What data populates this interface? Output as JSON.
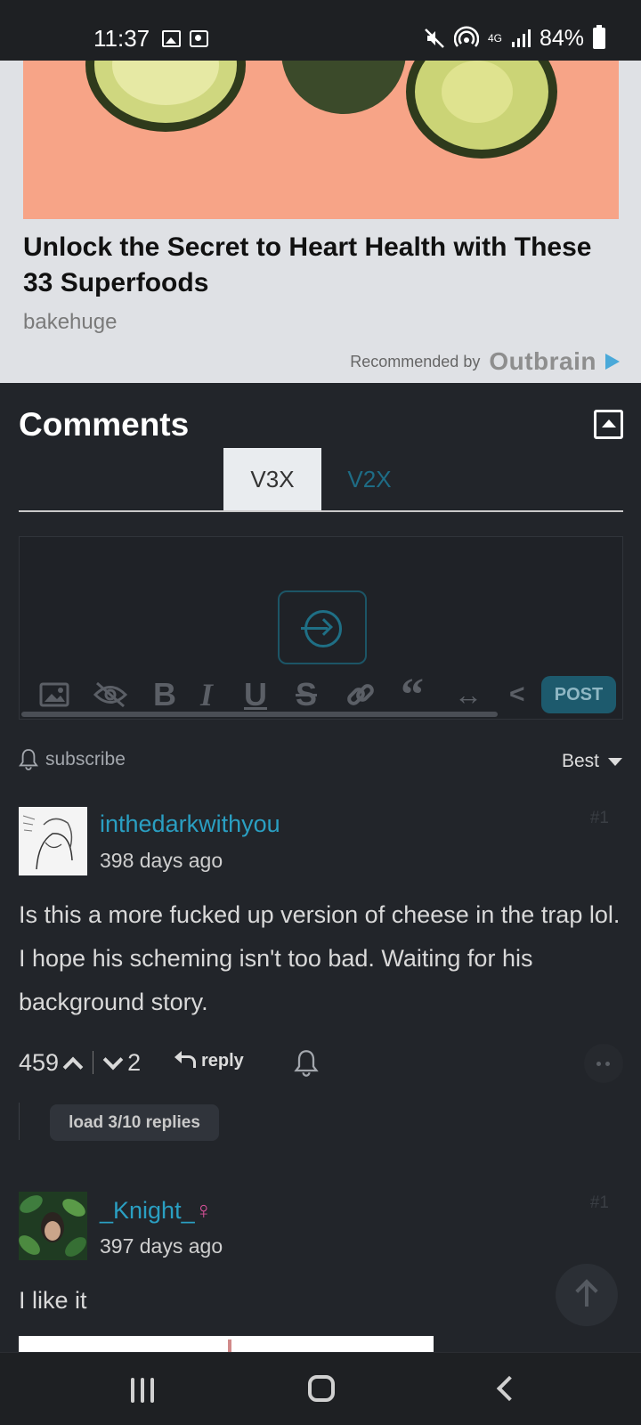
{
  "status_bar": {
    "time": "11:37",
    "network": "4G",
    "battery": "84%"
  },
  "ad": {
    "title": "Unlock the Secret to Heart Health with These 33 Superfoods",
    "source": "bakehuge",
    "recommended_by": "Recommended by",
    "brand": "Outbrain"
  },
  "comments": {
    "title": "Comments",
    "tabs": [
      {
        "label": "V3X",
        "active": true
      },
      {
        "label": "V2X",
        "active": false
      }
    ],
    "editor": {
      "post_label": "POST",
      "tools": [
        "image-icon",
        "spoiler-icon",
        "bold-icon",
        "italic-icon",
        "underline-icon",
        "strikethrough-icon",
        "link-icon",
        "quote-icon",
        "arrows-icon",
        "code-icon"
      ]
    },
    "subscribe_label": "subscribe",
    "sort_label": "Best",
    "items": [
      {
        "username": "inthedarkwithyou",
        "time_ago": "398 days ago",
        "number": "#1",
        "text": "Is this a more fucked up version of cheese in the trap lol. I hope his scheming isn't too bad. Waiting for his background story.",
        "upvotes": "459",
        "downvotes": "2",
        "reply_label": "reply",
        "load_replies_label": "load 3/10 replies"
      },
      {
        "username": "_Knight_",
        "gender_symbol": "♀",
        "time_ago": "397 days ago",
        "number": "#1",
        "text": "I like it"
      }
    ]
  },
  "colors": {
    "background": "#22252a",
    "accent": "#2a9fc2",
    "ad_background": "#dfe1e5"
  }
}
